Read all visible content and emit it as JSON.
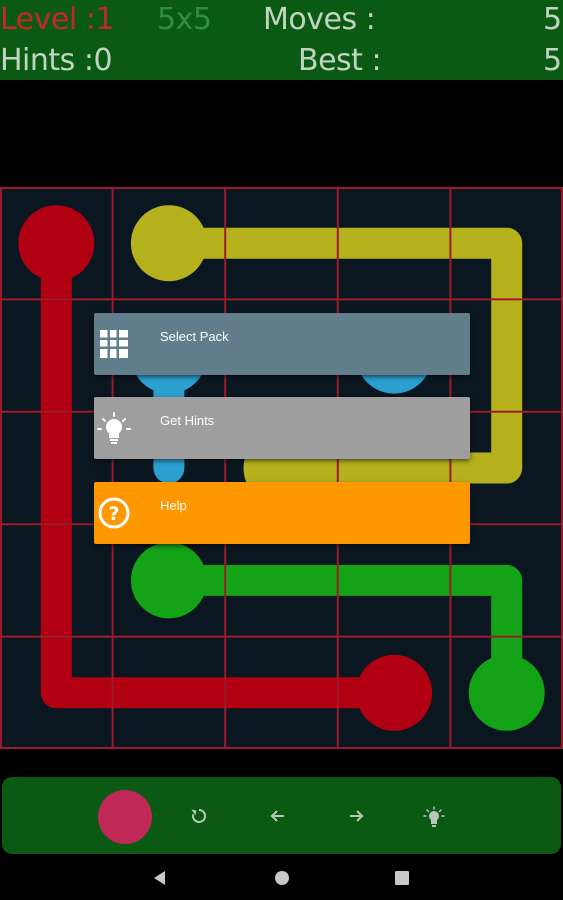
{
  "header": {
    "level_text": "Level :1",
    "size_text": "5x5",
    "moves_label": "Moves :",
    "moves_value": "5",
    "hints_text": "Hints :0",
    "best_label": "Best :",
    "best_value": "5"
  },
  "colors": {
    "header_bg": "#0b5a14",
    "level_text": "#c62828",
    "size_text": "#2f8f39",
    "header_text": "#c0d4c0",
    "board_bg": "#0b1720",
    "grid_line": "#9c1b2b",
    "red": "#b10012",
    "yellow": "#b5b11c",
    "green": "#14a317",
    "blue": "#2b9fd0",
    "select_pack_bg": "#627d8b",
    "get_hints_bg": "#9e9e9e",
    "help_bg": "#ff9800",
    "toolbar_bg": "#0b5a14",
    "selected_color": "#c02858"
  },
  "board": {
    "grid_size": 5,
    "flows": [
      {
        "color": "red",
        "endpoints": [
          [
            0,
            0
          ],
          [
            3,
            4
          ]
        ],
        "path": [
          [
            0,
            0
          ],
          [
            0,
            1
          ],
          [
            0,
            2
          ],
          [
            0,
            3
          ],
          [
            0,
            4
          ],
          [
            1,
            4
          ],
          [
            2,
            4
          ],
          [
            3,
            4
          ]
        ]
      },
      {
        "color": "yellow",
        "endpoints": [
          [
            1,
            0
          ],
          [
            2,
            2
          ]
        ],
        "path": [
          [
            1,
            0
          ],
          [
            2,
            0
          ],
          [
            3,
            0
          ],
          [
            4,
            0
          ],
          [
            4,
            1
          ],
          [
            4,
            2
          ],
          [
            3,
            2
          ],
          [
            2,
            2
          ]
        ]
      },
      {
        "color": "green",
        "endpoints": [
          [
            1,
            3
          ],
          [
            4,
            4
          ]
        ],
        "path": [
          [
            1,
            3
          ],
          [
            2,
            3
          ],
          [
            3,
            3
          ],
          [
            4,
            3
          ],
          [
            4,
            4
          ]
        ]
      },
      {
        "color": "blue",
        "endpoints": [
          [
            1,
            1
          ],
          [
            3,
            1
          ]
        ],
        "path": [
          [
            1,
            1
          ],
          [
            1,
            2
          ]
        ]
      }
    ]
  },
  "menu": {
    "items": [
      {
        "label": "Select Pack",
        "icon": "grid-icon",
        "color": "#627d8b"
      },
      {
        "label": "Get Hints",
        "icon": "lightbulb-icon",
        "color": "#9e9e9e"
      },
      {
        "label": "Help",
        "icon": "help-circle-icon",
        "color": "#ff9800"
      }
    ]
  },
  "toolbar": {
    "buttons": [
      "color-indicator",
      "undo-icon",
      "arrow-left-icon",
      "arrow-right-icon",
      "lightbulb-icon"
    ]
  },
  "navbar": {
    "buttons": [
      "back-icon",
      "home-icon",
      "recents-icon"
    ]
  }
}
